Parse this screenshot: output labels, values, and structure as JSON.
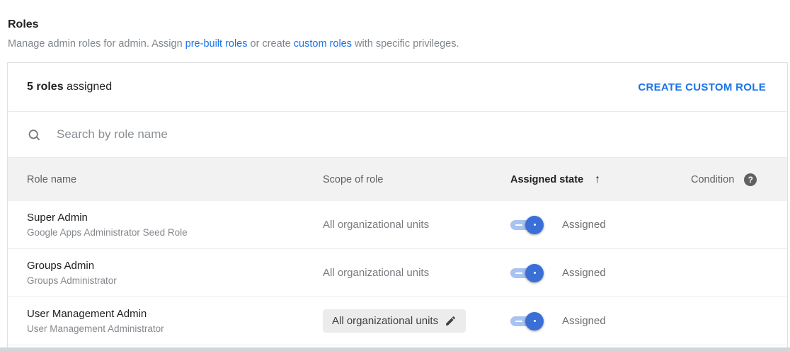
{
  "page": {
    "title": "Roles",
    "description": {
      "part1": "Manage admin roles for admin. Assign ",
      "link_prebuilt": "pre-built roles",
      "part2": " or create ",
      "link_custom": "custom roles",
      "part3": " with specific privileges."
    }
  },
  "card": {
    "header": {
      "count_bold": "5 roles",
      "count_regular": " assigned",
      "action_button": "CREATE CUSTOM ROLE"
    },
    "search": {
      "placeholder": "Search by role name"
    }
  },
  "table": {
    "columns": {
      "role_name": "Role name",
      "scope": "Scope of role",
      "assigned_state": "Assigned state",
      "condition": "Condition"
    },
    "sort": {
      "column": "Assigned state",
      "direction": "ascending",
      "arrow": "↑"
    },
    "help_glyph": "?",
    "rows": [
      {
        "name": "Super Admin",
        "description": "Google Apps Administrator Seed Role",
        "scope": "All organizational units",
        "scope_editable": false,
        "toggle": "on",
        "state": "Assigned"
      },
      {
        "name": "Groups Admin",
        "description": "Groups Administrator",
        "scope": "All organizational units",
        "scope_editable": false,
        "toggle": "on",
        "state": "Assigned"
      },
      {
        "name": "User Management Admin",
        "description": "User Management Administrator",
        "scope": "All organizational units",
        "scope_editable": true,
        "toggle": "on",
        "state": "Assigned"
      }
    ]
  },
  "colors": {
    "link_blue": "#1a73e8",
    "toggle_knob": "#3a6fd8",
    "toggle_track": "#a9c3f1",
    "table_header_bg": "#f2f2f2",
    "chip_bg": "#ececec"
  }
}
